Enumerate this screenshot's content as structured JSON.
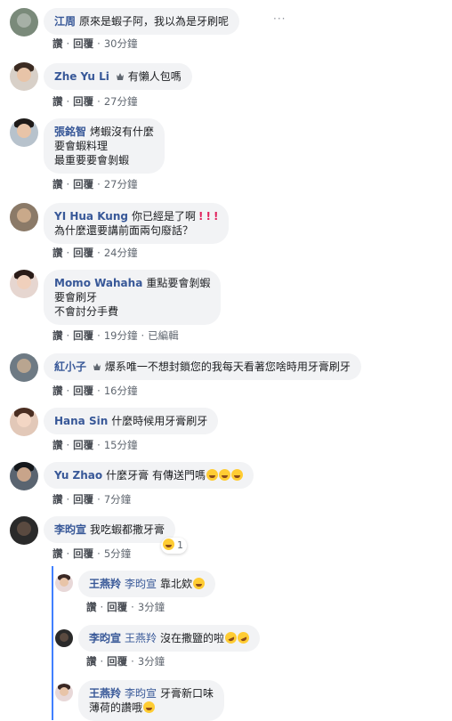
{
  "actions": {
    "like": "讚",
    "reply": "回覆",
    "edited": "已編輯"
  },
  "comments": [
    {
      "name": "江周",
      "text": [
        "原來是蝦子阿，我以為是牙刷呢"
      ],
      "time": "30分鐘"
    },
    {
      "name": "Zhe Yu Li",
      "text": [
        "有懶人包嗎"
      ],
      "time": "27分鐘"
    },
    {
      "name": "張銘智",
      "text": [
        "烤蝦沒有什麼",
        "要會蝦料理",
        "最重要要會剝蝦"
      ],
      "time": "27分鐘"
    },
    {
      "name": "YI Hua Kung",
      "text": [
        "你已經是了啊",
        "為什麼還要講前面兩句廢話？"
      ],
      "time": "24分鐘"
    },
    {
      "name": "Momo Wahaha",
      "text": [
        "重點要會剝蝦",
        "要會刷牙",
        "不會討分手費"
      ],
      "time": "19分鐘"
    },
    {
      "name": "紅小子",
      "text": [
        "爆系唯一不想封鎖您的我每天看著您啥時用牙膏刷牙"
      ],
      "time": "16分鐘"
    },
    {
      "name": "Hana Sin",
      "text": [
        "什麼時候用牙膏刷牙"
      ],
      "time": "15分鐘"
    },
    {
      "name": "Yu Zhao",
      "text": [
        "什麼牙膏 有傳送門嗎"
      ],
      "time": "7分鐘"
    },
    {
      "name": "李昀宣",
      "text": [
        "我吃蝦都撒牙膏"
      ],
      "time": "5分鐘",
      "reaction_count": "1"
    }
  ],
  "replies": [
    {
      "name": "王燕羚",
      "mention": "李昀宣",
      "text": [
        "靠北欸"
      ],
      "time": "3分鐘"
    },
    {
      "name": "李昀宣",
      "mention": "王燕羚",
      "text": [
        "沒在撒鹽的啦"
      ],
      "time": "3分鐘"
    },
    {
      "name": "王燕羚",
      "mention": "李昀宣",
      "text": [
        "牙膏新口味",
        "薄荷的讚哦"
      ],
      "time": ""
    }
  ],
  "icons": {
    "more": "more-options-icon",
    "badge": "top-fan-badge-icon"
  },
  "colors": {
    "name": "#385898",
    "bubble": "#f2f3f5",
    "thread": "#4080ff",
    "exclaim": "#e0245e"
  }
}
